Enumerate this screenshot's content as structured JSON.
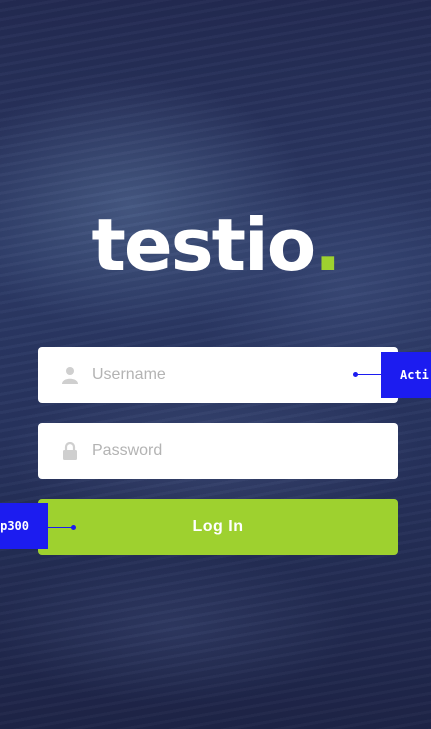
{
  "brand": {
    "name": "testio",
    "dot": ".",
    "accent_color": "#9ed12f"
  },
  "form": {
    "username": {
      "placeholder": "Username",
      "value": "",
      "icon": "user-icon"
    },
    "password": {
      "placeholder": "Password",
      "value": "",
      "icon": "lock-icon"
    },
    "login_label": "Log In"
  },
  "annotations": {
    "right_tag": "Acti",
    "left_tag": "p300",
    "color": "#1c1cf0"
  }
}
